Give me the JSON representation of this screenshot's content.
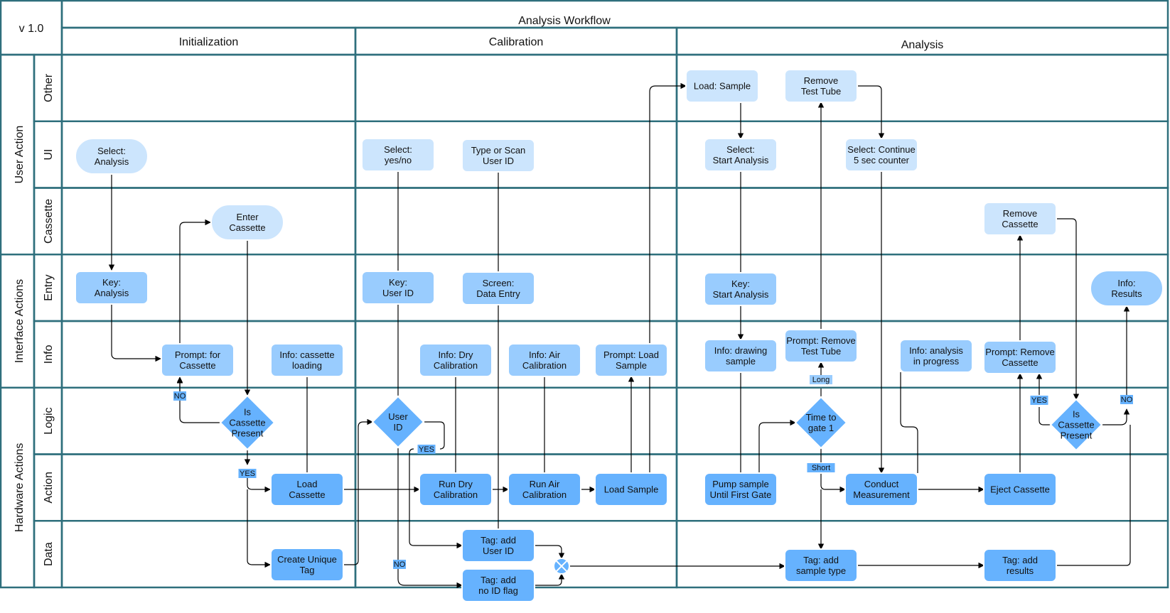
{
  "header": {
    "version": "v 1.0",
    "title": "Analysis Workflow"
  },
  "phases": [
    {
      "id": "init",
      "label": "Initialization"
    },
    {
      "id": "cal",
      "label": "Calibration"
    },
    {
      "id": "ana",
      "label": "Analysis"
    }
  ],
  "groups": [
    {
      "id": "user",
      "label": "User Action",
      "lanes": [
        "other",
        "ui",
        "cassette"
      ]
    },
    {
      "id": "iface",
      "label": "Interface Actions",
      "lanes": [
        "entry",
        "info"
      ]
    },
    {
      "id": "hw",
      "label": "Hardware Actions",
      "lanes": [
        "logic",
        "action",
        "data"
      ]
    }
  ],
  "lanes": [
    {
      "id": "other",
      "label": "Other"
    },
    {
      "id": "ui",
      "label": "UI"
    },
    {
      "id": "cassette",
      "label": "Cassette"
    },
    {
      "id": "entry",
      "label": "Entry"
    },
    {
      "id": "info",
      "label": "Info"
    },
    {
      "id": "logic",
      "label": "Logic"
    },
    {
      "id": "action",
      "label": "Action"
    },
    {
      "id": "data",
      "label": "Data"
    }
  ],
  "colors": {
    "border": "#2e6f7c",
    "header_fill": "#dbe1e8",
    "title_fill": "#e8f1fa",
    "group_label_fill": "#e8f1fa",
    "user_lane_fill": "#cce5fd",
    "interface_lane_fill": "#99ccfe",
    "hardware_lane_fill": "#66b2fe",
    "node_stroke": "#ffffff",
    "edge": "#000000"
  },
  "nodes": [
    {
      "id": "select_analysis",
      "shape": "terminator",
      "lines": [
        "Select:",
        "Analysis"
      ]
    },
    {
      "id": "enter_cassette",
      "shape": "terminator",
      "lines": [
        "Enter",
        "Cassette"
      ]
    },
    {
      "id": "key_analysis",
      "shape": "process",
      "lines": [
        "Key:",
        "Analysis"
      ]
    },
    {
      "id": "prompt_cassette",
      "shape": "process",
      "lines": [
        "Prompt: for",
        "Cassette"
      ]
    },
    {
      "id": "info_cassette_loading",
      "shape": "process",
      "lines": [
        "Info: cassette",
        "loading"
      ]
    },
    {
      "id": "is_cassette_present_1",
      "shape": "decision",
      "lines": [
        "Is",
        "Cassette",
        "Present"
      ]
    },
    {
      "id": "load_cassette",
      "shape": "process",
      "lines": [
        "Load",
        "Cassette"
      ]
    },
    {
      "id": "create_unique_tag",
      "shape": "process",
      "lines": [
        "Create Unique",
        "Tag"
      ]
    },
    {
      "id": "select_yes_no",
      "shape": "process",
      "lines": [
        "Select:",
        "yes/no"
      ]
    },
    {
      "id": "type_scan_user_id",
      "shape": "process",
      "lines": [
        "Type or Scan",
        "User ID"
      ]
    },
    {
      "id": "key_user_id",
      "shape": "process",
      "lines": [
        "Key:",
        "User ID"
      ]
    },
    {
      "id": "screen_data_entry",
      "shape": "process",
      "lines": [
        "Screen:",
        "Data Entry"
      ]
    },
    {
      "id": "info_dry_cal",
      "shape": "process",
      "lines": [
        "Info: Dry",
        "Calibration"
      ]
    },
    {
      "id": "info_air_cal",
      "shape": "process",
      "lines": [
        "Info: Air",
        "Calibration"
      ]
    },
    {
      "id": "prompt_load_sample",
      "shape": "process",
      "lines": [
        "Prompt: Load",
        "Sample"
      ]
    },
    {
      "id": "user_id_decision",
      "shape": "decision",
      "lines": [
        "User",
        "ID"
      ]
    },
    {
      "id": "run_dry_cal",
      "shape": "process",
      "lines": [
        "Run Dry",
        "Calibration"
      ]
    },
    {
      "id": "run_air_cal",
      "shape": "process",
      "lines": [
        "Run Air",
        "Calibration"
      ]
    },
    {
      "id": "load_sample",
      "shape": "process",
      "lines": [
        "Load Sample"
      ]
    },
    {
      "id": "tag_user_id",
      "shape": "process",
      "lines": [
        "Tag: add",
        "User ID"
      ]
    },
    {
      "id": "tag_no_id_flag",
      "shape": "process",
      "lines": [
        "Tag: add",
        "no ID flag"
      ]
    },
    {
      "id": "merge_gateway",
      "shape": "gateway",
      "lines": []
    },
    {
      "id": "load_sample_other",
      "shape": "process",
      "lines": [
        "Load: Sample"
      ]
    },
    {
      "id": "remove_test_tube",
      "shape": "process",
      "lines": [
        "Remove",
        "Test Tube"
      ]
    },
    {
      "id": "select_start_analysis",
      "shape": "process",
      "lines": [
        "Select:",
        "Start Analysis"
      ]
    },
    {
      "id": "select_continue",
      "shape": "process",
      "lines": [
        "Select: Continue",
        "5 sec counter"
      ]
    },
    {
      "id": "remove_cassette",
      "shape": "process",
      "lines": [
        "Remove",
        "Cassette"
      ]
    },
    {
      "id": "key_start_analysis",
      "shape": "process",
      "lines": [
        "Key:",
        "Start Analysis"
      ]
    },
    {
      "id": "info_results",
      "shape": "terminator",
      "lines": [
        "Info:",
        "Results"
      ]
    },
    {
      "id": "info_drawing_sample",
      "shape": "process",
      "lines": [
        "Info: drawing",
        "sample"
      ]
    },
    {
      "id": "prompt_remove_test_tube",
      "shape": "process",
      "lines": [
        "Prompt: Remove",
        "Test Tube"
      ]
    },
    {
      "id": "info_analysis_progress",
      "shape": "process",
      "lines": [
        "Info: analysis",
        "in progress"
      ]
    },
    {
      "id": "prompt_remove_cassette",
      "shape": "process",
      "lines": [
        "Prompt: Remove",
        "Cassette"
      ]
    },
    {
      "id": "time_to_gate",
      "shape": "decision",
      "lines": [
        "Time to",
        "gate 1"
      ]
    },
    {
      "id": "is_cassette_present_2",
      "shape": "decision",
      "lines": [
        "Is",
        "Cassette",
        "Present"
      ]
    },
    {
      "id": "pump_sample",
      "shape": "process",
      "lines": [
        "Pump sample",
        "Until First Gate"
      ]
    },
    {
      "id": "conduct_measurement",
      "shape": "process",
      "lines": [
        "Conduct",
        "Measurement"
      ]
    },
    {
      "id": "eject_cassette",
      "shape": "process",
      "lines": [
        "Eject Cassette"
      ]
    },
    {
      "id": "tag_sample_type",
      "shape": "process",
      "lines": [
        "Tag: add",
        "sample type"
      ]
    },
    {
      "id": "tag_results",
      "shape": "process",
      "lines": [
        "Tag: add",
        "results"
      ]
    }
  ],
  "edge_labels": [
    {
      "id": "no_1",
      "text": "NO"
    },
    {
      "id": "yes_1",
      "text": "YES"
    },
    {
      "id": "yes_2",
      "text": "YES"
    },
    {
      "id": "no_2",
      "text": "NO"
    },
    {
      "id": "long",
      "text": "Long"
    },
    {
      "id": "short",
      "text": "Short"
    },
    {
      "id": "yes_3",
      "text": "YES"
    },
    {
      "id": "no_3",
      "text": "NO"
    }
  ]
}
